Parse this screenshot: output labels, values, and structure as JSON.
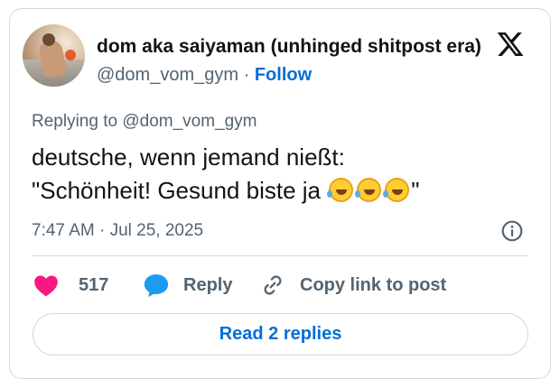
{
  "author": {
    "name": "dom aka saiyaman (unhinged shitpost era)",
    "handle": "@dom_vom_gym",
    "separator": "·",
    "follow_label": "Follow"
  },
  "tweet": {
    "replying_to": "Replying to @dom_vom_gym",
    "line1": "deutsche, wenn jemand nießt:",
    "line2_start": "\"Schönheit! Gesund biste ja ",
    "line2_end": "\"",
    "emojis": [
      "rolling-on-floor-laughing",
      "rolling-on-floor-laughing",
      "rolling-on-floor-laughing"
    ],
    "timestamp": "7:47 AM · Jul 25, 2025"
  },
  "actions": {
    "like_count": "517",
    "reply_label": "Reply",
    "copy_label": "Copy link to post"
  },
  "read_replies_label": "Read 2 replies",
  "colors": {
    "like": "#f91880",
    "reply": "#1d9bf0",
    "link": "#006fd6",
    "muted": "#536471",
    "border": "#cfd9de"
  },
  "icons": [
    "x-logo-icon",
    "info-icon",
    "heart-icon",
    "reply-bubble-icon",
    "link-icon"
  ]
}
